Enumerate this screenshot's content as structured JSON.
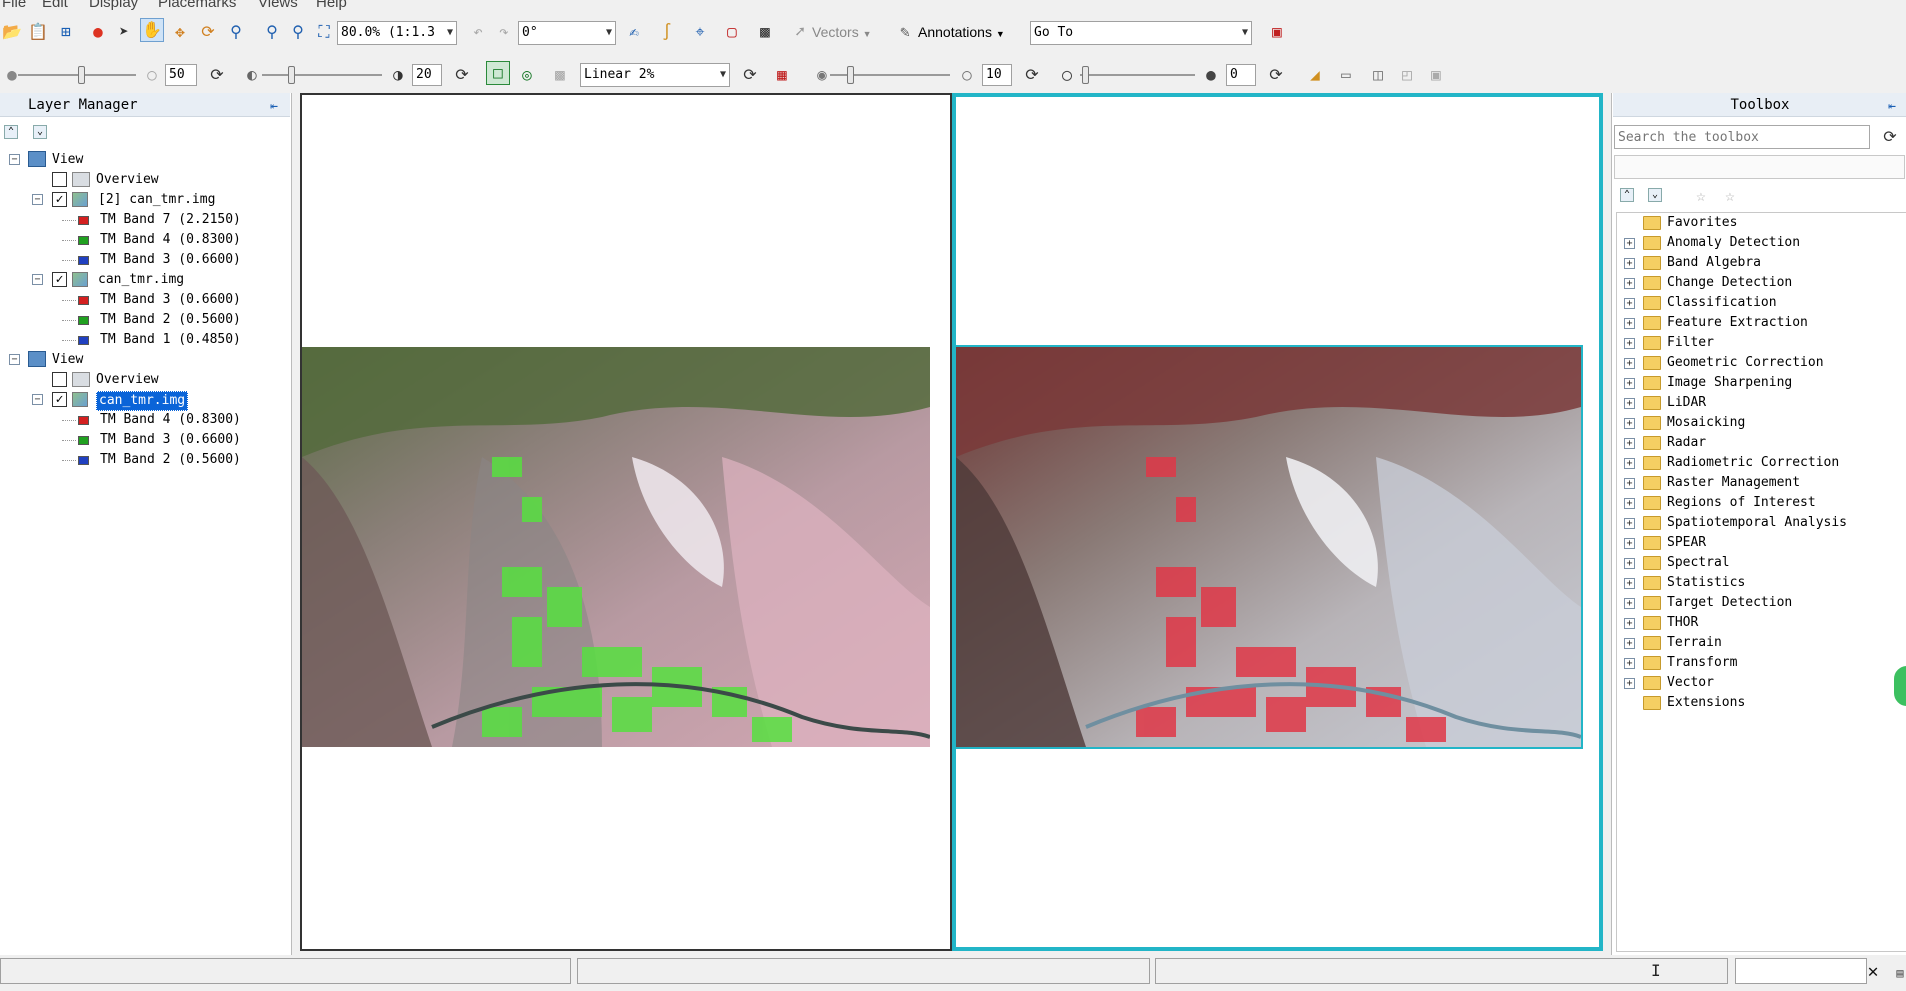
{
  "menu": [
    "File",
    "Edit",
    "Display",
    "Placemarks",
    "Views",
    "Help"
  ],
  "toolbar": {
    "zoom_value": "80.0% (1:1.3",
    "rotation_value": "0°",
    "vectors_label": "Vectors",
    "annotations_label": "Annotations",
    "goto_value": "Go To"
  },
  "enhance": {
    "brightness": "50",
    "contrast": "20",
    "stretch": "Linear 2%",
    "sharpen": "10",
    "transparency": "0"
  },
  "layer_manager": {
    "title": "Layer Manager",
    "views": [
      {
        "label": "View",
        "overview": "Overview",
        "layers": [
          {
            "name": "[2] can_tmr.img",
            "checked": true,
            "bands": [
              {
                "label": "TM Band 7 (2.2150)",
                "color": "#d42020"
              },
              {
                "label": "TM Band 4 (0.8300)",
                "color": "#20a020"
              },
              {
                "label": "TM Band 3 (0.6600)",
                "color": "#2040c0"
              }
            ]
          },
          {
            "name": "can_tmr.img",
            "checked": true,
            "bands": [
              {
                "label": "TM Band 3 (0.6600)",
                "color": "#d42020"
              },
              {
                "label": "TM Band 2 (0.5600)",
                "color": "#20a020"
              },
              {
                "label": "TM Band 1 (0.4850)",
                "color": "#2040c0"
              }
            ]
          }
        ]
      },
      {
        "label": "View",
        "overview": "Overview",
        "layers": [
          {
            "name": "can_tmr.img",
            "checked": true,
            "selected": true,
            "bands": [
              {
                "label": "TM Band 4 (0.8300)",
                "color": "#d42020"
              },
              {
                "label": "TM Band 3 (0.6600)",
                "color": "#20a020"
              },
              {
                "label": "TM Band 2 (0.5600)",
                "color": "#2040c0"
              }
            ]
          }
        ]
      }
    ]
  },
  "toolbox": {
    "title": "Toolbox",
    "search_placeholder": "Search the toolbox",
    "folders": [
      "Favorites",
      "Anomaly Detection",
      "Band Algebra",
      "Change Detection",
      "Classification",
      "Feature Extraction",
      "Filter",
      "Geometric Correction",
      "Image Sharpening",
      "LiDAR",
      "Mosaicking",
      "Radar",
      "Radiometric Correction",
      "Raster Management",
      "Regions of Interest",
      "Spatiotemporal Analysis",
      "SPEAR",
      "Spectral",
      "Statistics",
      "Target Detection",
      "THOR",
      "Terrain",
      "Transform",
      "Vector",
      "Extensions"
    ]
  },
  "colors": {
    "accent": "#22b5c7",
    "selection": "#0a64d8"
  }
}
